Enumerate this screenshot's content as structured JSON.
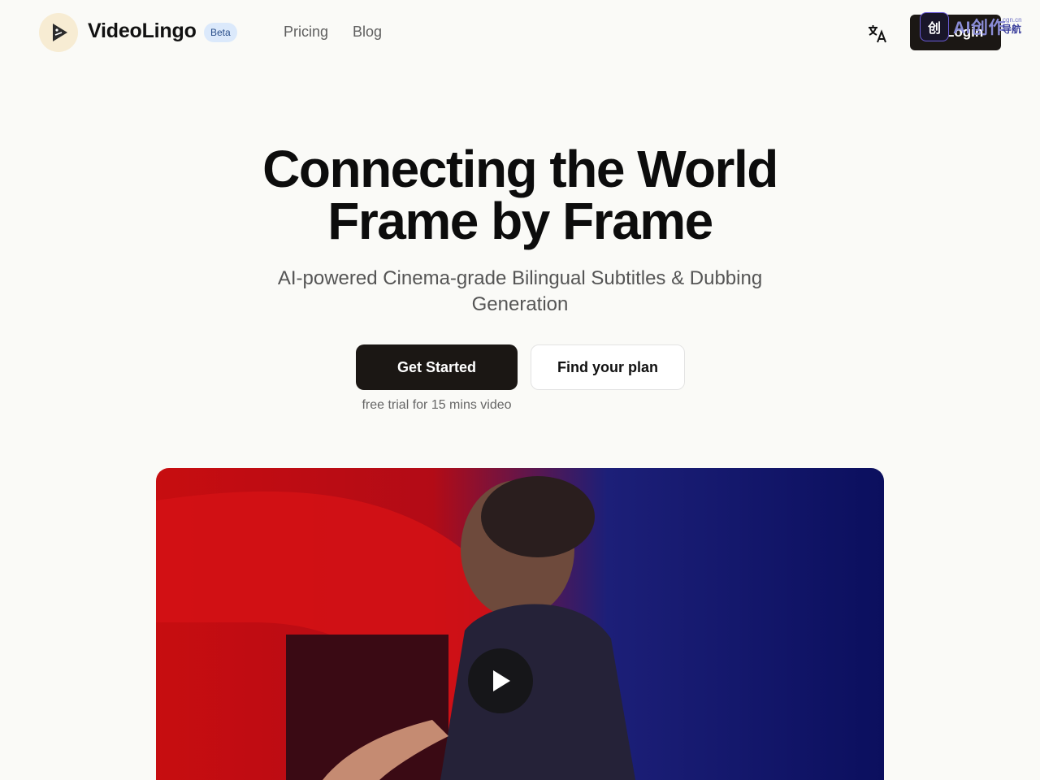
{
  "header": {
    "brand": "VideoLingo",
    "badge": "Beta",
    "nav": [
      {
        "label": "Pricing"
      },
      {
        "label": "Blog"
      }
    ],
    "language_icon": "translate-icon",
    "login_label": "Login",
    "watermark": {
      "icon_char": "创",
      "text": "AI创作",
      "small": "cgn.cn",
      "sub": "导航"
    }
  },
  "hero": {
    "title_line1": "Connecting the World",
    "title_line2": "Frame by Frame",
    "subtitle": "AI-powered Cinema-grade Bilingual Subtitles & Dubbing Generation",
    "cta_primary": "Get Started",
    "cta_secondary": "Find your plan",
    "trial_note": "free trial for 15 mins video"
  },
  "video": {
    "play_icon": "play-icon"
  },
  "colors": {
    "background": "#fafaf7",
    "primary_button": "#1b1714",
    "badge_bg": "#dbe9fb",
    "badge_text": "#2a4f8a"
  }
}
